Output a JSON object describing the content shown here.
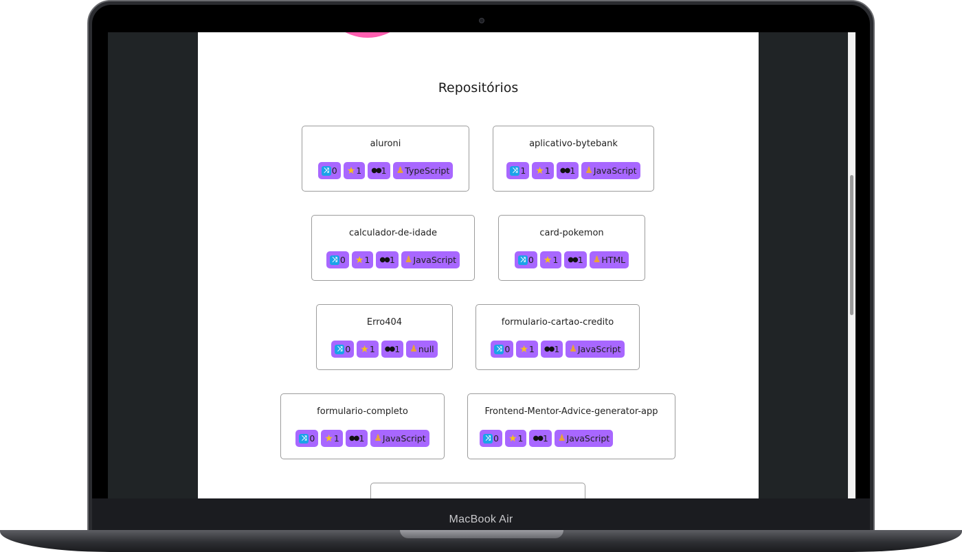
{
  "device": {
    "label": "MacBook Air"
  },
  "page": {
    "section_title": "Repositórios"
  },
  "icons": {
    "forks": "twisted-arrows-icon",
    "stars": "star-icon",
    "watchers": "eyes-icon",
    "language": "technologist-icon"
  },
  "colors": {
    "badge": "#a867ff",
    "avatar": "#ff5fb0",
    "card_border": "#9b9b9b"
  },
  "repos": [
    {
      "name": "aluroni",
      "forks": "0",
      "stars": "1",
      "watchers": "1",
      "language": "TypeScript"
    },
    {
      "name": "aplicativo-bytebank",
      "forks": "1",
      "stars": "1",
      "watchers": "1",
      "language": "JavaScript"
    },
    {
      "name": "calculador-de-idade",
      "forks": "0",
      "stars": "1",
      "watchers": "1",
      "language": "JavaScript"
    },
    {
      "name": "card-pokemon",
      "forks": "0",
      "stars": "1",
      "watchers": "1",
      "language": "HTML"
    },
    {
      "name": "Erro404",
      "forks": "0",
      "stars": "1",
      "watchers": "1",
      "language": "null"
    },
    {
      "name": "formulario-cartao-credito",
      "forks": "0",
      "stars": "1",
      "watchers": "1",
      "language": "JavaScript"
    },
    {
      "name": "formulario-completo",
      "forks": "0",
      "stars": "1",
      "watchers": "1",
      "language": "JavaScript"
    },
    {
      "name": "Frontend-Mentor-Advice-generator-app",
      "forks": "0",
      "stars": "1",
      "watchers": "1",
      "language": "JavaScript"
    }
  ]
}
